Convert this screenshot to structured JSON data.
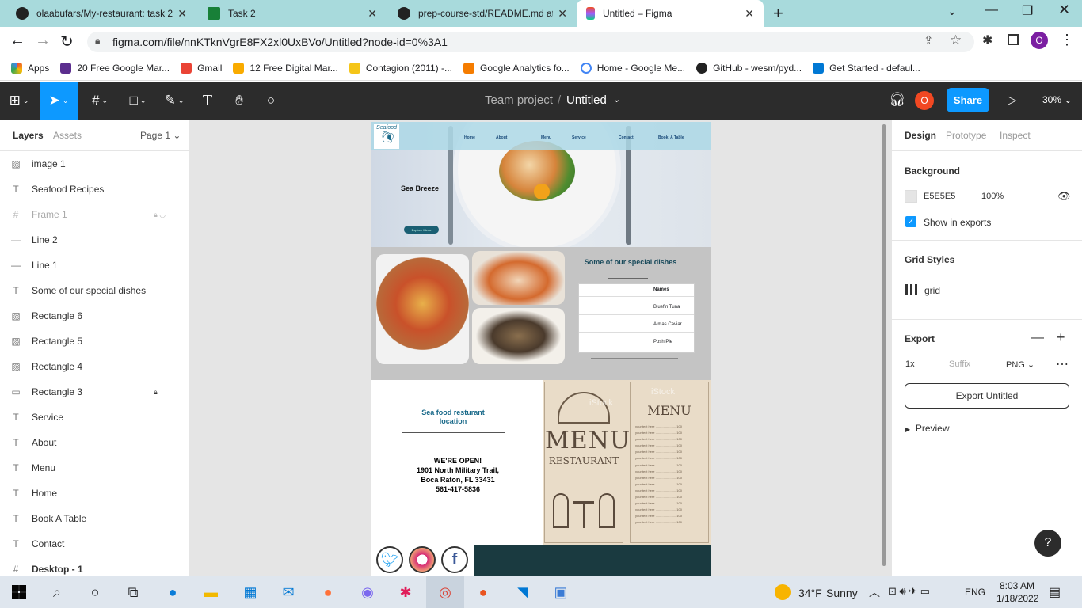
{
  "browser": {
    "tabs": [
      {
        "title": "olaabufars/My-restaurant: task 2",
        "close": "✕"
      },
      {
        "title": "Task 2",
        "close": "✕"
      },
      {
        "title": "prep-course-std/README.md at",
        "close": "✕"
      },
      {
        "title": "Untitled – Figma",
        "close": "✕"
      }
    ],
    "new_tab": "+",
    "url": "figma.com/file/nnKTknVgrE8FX2xl0UxBVo/Untitled?node-id=0%3A1",
    "profile_initial": "O",
    "bookmarks": [
      "Apps",
      "20 Free Google Mar...",
      "Gmail",
      "12 Free Digital Mar...",
      "Contagion (2011) -...",
      "Google Analytics fo...",
      "Home - Google Me...",
      "GitHub - wesm/pyd...",
      "Get Started - defaul..."
    ]
  },
  "figma": {
    "project": "Team project",
    "separator": "/",
    "file": "Untitled",
    "avatar_initial": "O",
    "share": "Share",
    "zoom": "30%",
    "left": {
      "tab_layers": "Layers",
      "tab_assets": "Assets",
      "page": "Page 1",
      "layers": [
        {
          "icon": "img",
          "name": "image 1"
        },
        {
          "icon": "T",
          "name": "Seafood Recipes"
        },
        {
          "icon": "#",
          "name": "Frame 1"
        },
        {
          "icon": "—",
          "name": "Line 2"
        },
        {
          "icon": "—",
          "name": "Line 1"
        },
        {
          "icon": "T",
          "name": "Some of our special dishes"
        },
        {
          "icon": "img",
          "name": "Rectangle 6"
        },
        {
          "icon": "img",
          "name": "Rectangle 5"
        },
        {
          "icon": "img",
          "name": "Rectangle 4"
        },
        {
          "icon": "rect",
          "name": "Rectangle 3"
        },
        {
          "icon": "T",
          "name": "Service"
        },
        {
          "icon": "T",
          "name": "About"
        },
        {
          "icon": "T",
          "name": "Menu"
        },
        {
          "icon": "T",
          "name": "Home"
        },
        {
          "icon": "T",
          "name": "Book A Table"
        },
        {
          "icon": "T",
          "name": "Contact"
        },
        {
          "icon": "#",
          "name": "Desktop - 1"
        }
      ]
    },
    "design": {
      "logo_text": "Seafood",
      "nav": [
        "Home",
        "About",
        "Menu",
        "Service",
        "Contact",
        "Book  A Table"
      ],
      "hero_title": "Sea Breeze",
      "hero_button": "Explore Menu",
      "special_title": "Some of our special dishes",
      "table_header": "Names",
      "dishes": [
        "Bluefin Tuna",
        "Almas Caviar",
        "Posh Pie"
      ],
      "location_title": "Sea food resturant location",
      "open_title": "WE'RE OPEN!",
      "address1": "1901 North Military Trail,",
      "address2": "Boca Raton, FL 33431",
      "phone": "561-417-5836",
      "menu_word": "MENU",
      "restaurant_word": "RESTAURANT",
      "menu_line": "your text here ........................100",
      "watermark": "iStock"
    },
    "right": {
      "tabs": [
        "Design",
        "Prototype",
        "Inspect"
      ],
      "background_label": "Background",
      "bg_hex": "E5E5E5",
      "bg_opacity": "100%",
      "show_exports": "Show in exports",
      "grid_label": "Grid Styles",
      "grid_name": "grid",
      "export_label": "Export",
      "scale": "1x",
      "suffix": "Suffix",
      "format": "PNG",
      "export_button": "Export Untitled",
      "preview": "Preview"
    },
    "help": "?"
  },
  "taskbar": {
    "temp": "34°F",
    "weather": "Sunny",
    "lang": "ENG",
    "time": "8:03 AM",
    "date": "1/18/2022"
  },
  "colors": {
    "figma_blue": "#0d99ff",
    "dark": "#2c2c2c",
    "tab_strip": "#a8dadc",
    "navy": "#1f3a4d",
    "teal": "#1a4b5c"
  }
}
